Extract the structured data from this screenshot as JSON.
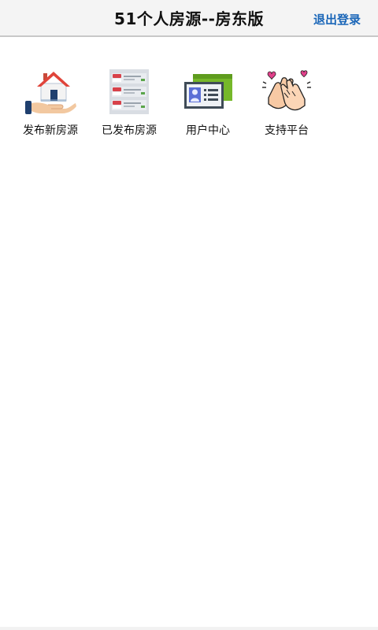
{
  "header": {
    "title": "51个人房源--房东版",
    "logout_label": "退出登录"
  },
  "menu": {
    "items": [
      {
        "label": "发布新房源",
        "icon": "house-in-hand-icon"
      },
      {
        "label": "已发布房源",
        "icon": "listing-list-icon"
      },
      {
        "label": "用户中心",
        "icon": "id-card-icon"
      },
      {
        "label": "支持平台",
        "icon": "clapping-hands-icon"
      }
    ]
  },
  "colors": {
    "header_bg": "#f4f4f4",
    "logout": "#1a66b8"
  }
}
